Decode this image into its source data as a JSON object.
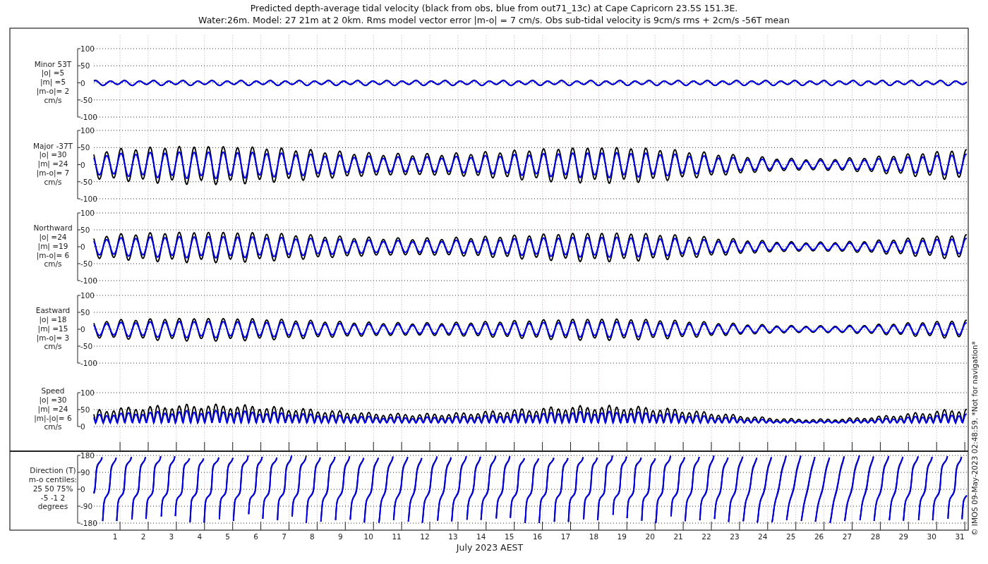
{
  "title": [
    "Predicted depth-average tidal velocity (black from obs, blue from out71_13c) at Cape Capricorn 23.5S 151.3E.",
    "Water:26m. Model: 27 21m at 2 0km. Rms model vector error |m-o| = 7 cm/s. Obs sub-tidal velocity is 9cm/s rms + 2cm/s -56T mean"
  ],
  "panels": [
    {
      "kind": "minor",
      "label": [
        "Minor 53T",
        "|o| =5",
        "|m| =5",
        "|m-o|= 2",
        "cm/s"
      ],
      "yticks": [
        "100",
        "50",
        "0",
        "-50",
        "-100"
      ]
    },
    {
      "kind": "major",
      "label": [
        "Major -37T",
        "|o| =30",
        "|m| =24",
        "|m-o|= 7",
        "cm/s"
      ],
      "yticks": [
        "100",
        "50",
        "0",
        "-50",
        "-100"
      ]
    },
    {
      "kind": "north",
      "label": [
        "Northward",
        "|o| =24",
        "|m| =19",
        "|m-o|= 6",
        "cm/s"
      ],
      "yticks": [
        "100",
        "50",
        "0",
        "-50",
        "-100"
      ]
    },
    {
      "kind": "east",
      "label": [
        "Eastward",
        "|o| =18",
        "|m| =15",
        "|m-o|= 3",
        "cm/s"
      ],
      "yticks": [
        "100",
        "50",
        "0",
        "-50",
        "-100"
      ]
    },
    {
      "kind": "speed",
      "label": [
        "Speed",
        "|o| =30",
        "|m| =24",
        "|m|-|o|= 6",
        "cm/s"
      ],
      "yticks": [
        "100",
        "50",
        "0"
      ]
    },
    {
      "kind": "direction",
      "label": [
        "Direction (T)",
        "m-o centiles:",
        "25  50  75%",
        "-5 -1  2",
        "degrees"
      ],
      "yticks": [
        "180",
        "90",
        "0",
        "-90",
        "-180"
      ]
    }
  ],
  "xticks": [
    "1",
    "2",
    "3",
    "4",
    "5",
    "6",
    "7",
    "8",
    "9",
    "10",
    "11",
    "12",
    "13",
    "14",
    "15",
    "16",
    "17",
    "18",
    "19",
    "20",
    "21",
    "22",
    "23",
    "24",
    "25",
    "26",
    "27",
    "28",
    "29",
    "30",
    "31"
  ],
  "xlabel": "July 2023 AEST",
  "credit": "© IMOS 09-May-2023 02:48:59. *Not for navigation*"
}
